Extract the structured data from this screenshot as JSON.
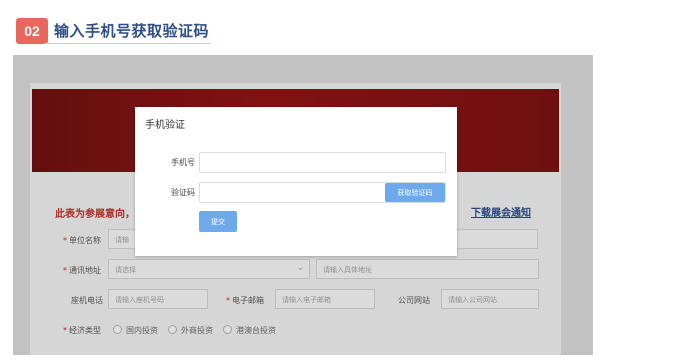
{
  "step": {
    "number": "02",
    "title": "输入手机号获取验证码"
  },
  "form_page": {
    "notice": "此表为参展意向，",
    "download_link": "下载展会通知",
    "rows": [
      {
        "label": "单位名称",
        "required": true,
        "placeholder": "请输"
      },
      {
        "label": "通讯地址",
        "required": true,
        "select_placeholder": "请选择",
        "detail_placeholder": "请输入具体地址"
      },
      {
        "label": "座机电话",
        "required": false,
        "placeholder": "请输入座机号码",
        "email_label": "电子邮箱",
        "email_placeholder": "请输入电子邮箱",
        "site_label": "公司网站",
        "site_placeholder": "请输入公司网站"
      },
      {
        "label": "经济类型",
        "required": true,
        "options": [
          "国内投资",
          "外商投资",
          "港澳台投资"
        ]
      }
    ]
  },
  "modal": {
    "title": "手机验证",
    "phone_label": "手机号",
    "phone_value": "",
    "code_label": "验证码",
    "code_value": "",
    "get_code_button": "获取验证码",
    "submit_button": "提交"
  },
  "colors": {
    "badge": "#e8685d",
    "title": "#2f4f86",
    "button": "#6ea9ec",
    "banner": "#8a1414"
  }
}
